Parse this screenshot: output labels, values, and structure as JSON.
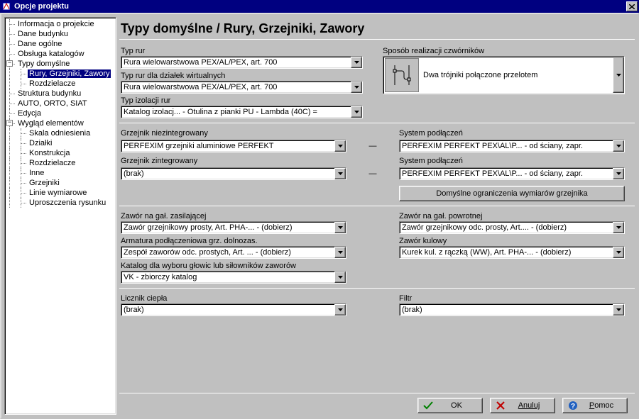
{
  "window": {
    "title": "Opcje projektu"
  },
  "tree": {
    "items": [
      {
        "label": "Informacja o projekcie",
        "indent": 1
      },
      {
        "label": "Dane budynku",
        "indent": 1
      },
      {
        "label": "Dane ogólne",
        "indent": 1
      },
      {
        "label": "Obsługa katalogów",
        "indent": 1
      },
      {
        "label": "Typy domyślne",
        "indent": 1,
        "expander": true
      },
      {
        "label": "Rury, Grzejniki, Zawory",
        "indent": 2,
        "selected": true
      },
      {
        "label": "Rozdzielacze",
        "indent": 2
      },
      {
        "label": "Struktura budynku",
        "indent": 1
      },
      {
        "label": "AUTO, ORTO, SIAT",
        "indent": 1
      },
      {
        "label": "Edycja",
        "indent": 1
      },
      {
        "label": "Wygląd elementów",
        "indent": 1,
        "expander": true
      },
      {
        "label": "Skala odniesienia",
        "indent": 2
      },
      {
        "label": "Działki",
        "indent": 2
      },
      {
        "label": "Konstrukcja",
        "indent": 2
      },
      {
        "label": "Rozdzielacze",
        "indent": 2
      },
      {
        "label": "Inne",
        "indent": 2
      },
      {
        "label": "Grzejniki",
        "indent": 2
      },
      {
        "label": "Linie wymiarowe",
        "indent": 2
      },
      {
        "label": "Uproszczenia rysunku",
        "indent": 2
      }
    ]
  },
  "page": {
    "title": "Typy domyślne / Rury, Grzejniki, Zawory"
  },
  "pipes": {
    "type_label": "Typ rur",
    "type_value": "Rura wielowarstwowa PEX/AL/PEX, art. 700",
    "virtual_label": "Typ rur dla działek wirtualnych",
    "virtual_value": "Rura wielowarstwowa PEX/AL/PEX, art. 700",
    "insulation_label": "Typ izolacji rur",
    "insulation_value": "Katalog izolacj... - Otulina z pianki PU - Lambda (40C) ="
  },
  "cross": {
    "label": "Sposób realizacji czwórników",
    "value": "Dwa trójniki połączone przelotem"
  },
  "radiators": {
    "nonint_label": "Grzejnik niezintegrowany",
    "nonint_value": "PERFEXIM grzejniki aluminiowe PERFEKT",
    "nonint_sys_label": "System podłączeń",
    "nonint_sys_value": "PERFEXIM PERFEKT PEX\\AL\\P... - od ściany, zapr.",
    "int_label": "Grzejnik zintegrowany",
    "int_value": "(brak)",
    "int_sys_label": "System podłączeń",
    "int_sys_value": "PERFEXIM PERFEKT PEX\\AL\\P... - od ściany, zapr.",
    "limits_button": "Domyślne ograniczenia wymiarów grzejnika"
  },
  "valves": {
    "supply_label": "Zawór na gał. zasilającej",
    "supply_value": "Zawór grzejnikowy prosty, Art. PHA-... - (dobierz)",
    "return_label": "Zawór na gał. powrotnej",
    "return_value": "Zawór grzejnikowy odc. prosty, Art.... - (dobierz)",
    "fittings_label": "Armatura podłączeniowa grz. dolnozas.",
    "fittings_value": "Zespół zaworów odc. prostych, Art. ... - (dobierz)",
    "ball_label": "Zawór kulowy",
    "ball_value": "Kurek kul. z rączką (WW), Art. PHA-... - (dobierz)",
    "catalog_label": "Katalog dla wyboru głowic lub siłowników zaworów",
    "catalog_value": "VK - zbiorczy katalog"
  },
  "meters": {
    "heat_label": "Licznik ciepła",
    "heat_value": "(brak)",
    "filter_label": "Filtr",
    "filter_value": "(brak)"
  },
  "footer": {
    "ok": "OK",
    "cancel": "Anuluj",
    "help": "Pomoc"
  }
}
